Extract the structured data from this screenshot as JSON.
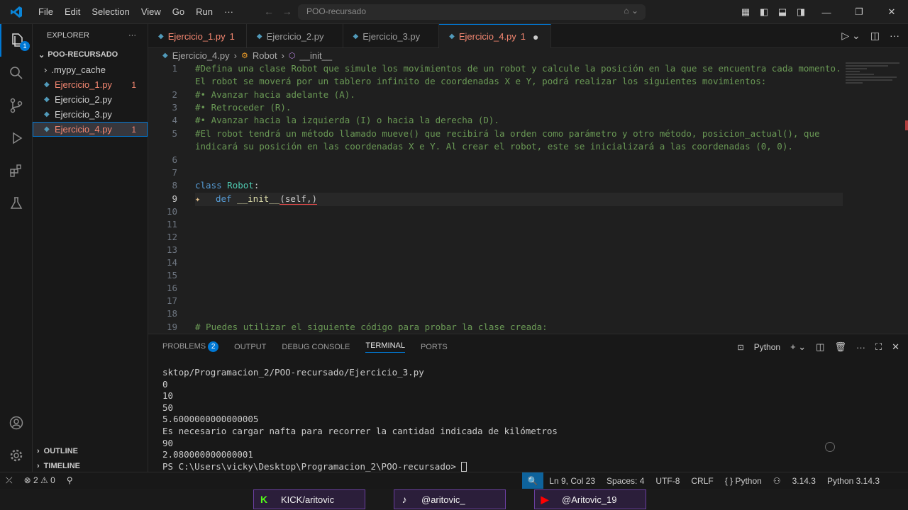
{
  "titlebar": {
    "menu": [
      "File",
      "Edit",
      "Selection",
      "View",
      "Go",
      "Run",
      "···"
    ],
    "search": "POO-recursado"
  },
  "sidebar": {
    "title": "EXPLORER",
    "folder": "POO-RECURSADO",
    "items": [
      {
        "label": ".mypy_cache",
        "count": ""
      },
      {
        "label": "Ejercicio_1.py",
        "count": "1"
      },
      {
        "label": "Ejercicio_2.py",
        "count": ""
      },
      {
        "label": "Ejercicio_3.py",
        "count": ""
      },
      {
        "label": "Ejercicio_4.py",
        "count": "1"
      }
    ],
    "outline": "OUTLINE",
    "timeline": "TIMELINE",
    "explorer_badge": "1"
  },
  "tabs": [
    {
      "label": "Ejercicio_1.py",
      "count": "1"
    },
    {
      "label": "Ejercicio_2.py"
    },
    {
      "label": "Ejercicio_3.py"
    },
    {
      "label": "Ejercicio_4.py",
      "count": "1"
    }
  ],
  "breadcrumb": {
    "file": "Ejercicio_4.py",
    "class": "Robot",
    "method": "__init__"
  },
  "editor": {
    "lines": [
      {
        "n": "1",
        "text": "#Defina una clase Robot que simule los movimientos de un robot y calcule la posición en la que se encuentra cada momento."
      },
      {
        "n": "",
        "text": "El robot se moverá por un tablero infinito de coordenadas X e Y, podrá realizar los siguientes movimientos:"
      },
      {
        "n": "2",
        "text": "#• Avanzar hacia adelante (A)."
      },
      {
        "n": "3",
        "text": "#• Retroceder (R)."
      },
      {
        "n": "4",
        "text": "#• Avanzar hacia la izquierda (I) o hacia la derecha (D)."
      },
      {
        "n": "5",
        "text": "#El robot tendrá un método llamado mueve() que recibirá la orden como parámetro y otro método, posicion_actual(), que"
      },
      {
        "n": "",
        "text": "indicará su posición en las coordenadas X e Y. Al crear el robot, este se inicializará a las coordenadas (0, 0)."
      },
      {
        "n": "6",
        "text": ""
      },
      {
        "n": "7",
        "text": ""
      },
      {
        "n": "8",
        "text": ""
      },
      {
        "n": "9",
        "text": ""
      },
      {
        "n": "10",
        "text": ""
      },
      {
        "n": "11",
        "text": ""
      },
      {
        "n": "12",
        "text": ""
      },
      {
        "n": "13",
        "text": ""
      },
      {
        "n": "14",
        "text": ""
      },
      {
        "n": "15",
        "text": ""
      },
      {
        "n": "16",
        "text": ""
      },
      {
        "n": "17",
        "text": ""
      },
      {
        "n": "18",
        "text": ""
      },
      {
        "n": "19",
        "text": "# Puedes utilizar el siguiente código para probar la clase creada:"
      }
    ],
    "class_kw": "class",
    "class_name": "Robot",
    "colon": ":",
    "def_kw": "def",
    "init_name": "__init__",
    "init_args": "(self,)"
  },
  "panel": {
    "tabs": [
      "PROBLEMS",
      "OUTPUT",
      "DEBUG CONSOLE",
      "TERMINAL",
      "PORTS"
    ],
    "problems_count": "2",
    "shell": "Python",
    "terminal": [
      "sktop/Programacion_2/POO-recursado/Ejercicio_3.py",
      "0",
      "10",
      "50",
      "5.6000000000000005",
      "Es necesario cargar nafta para recorrer la cantidad indicada de kilómetros",
      "90",
      "2.080000000000001",
      "PS C:\\Users\\vicky\\Desktop\\Programacion_2\\POO-recursado> "
    ]
  },
  "statusbar": {
    "errors": "2",
    "warnings": "0",
    "position": "Ln 9, Col 23",
    "spaces": "Spaces: 4",
    "encoding": "UTF-8",
    "eol": "CRLF",
    "language": "Python",
    "version": "3.14.3",
    "interpreter": "Python 3.14.3"
  },
  "overlay": [
    {
      "icon": "K",
      "label": "KICK/aritovic",
      "color": "#53fc18"
    },
    {
      "icon": "♪",
      "label": "@aritovic_",
      "color": "#ffffff"
    },
    {
      "icon": "▶",
      "label": "@Aritovic_19",
      "color": "#ff0000"
    }
  ]
}
